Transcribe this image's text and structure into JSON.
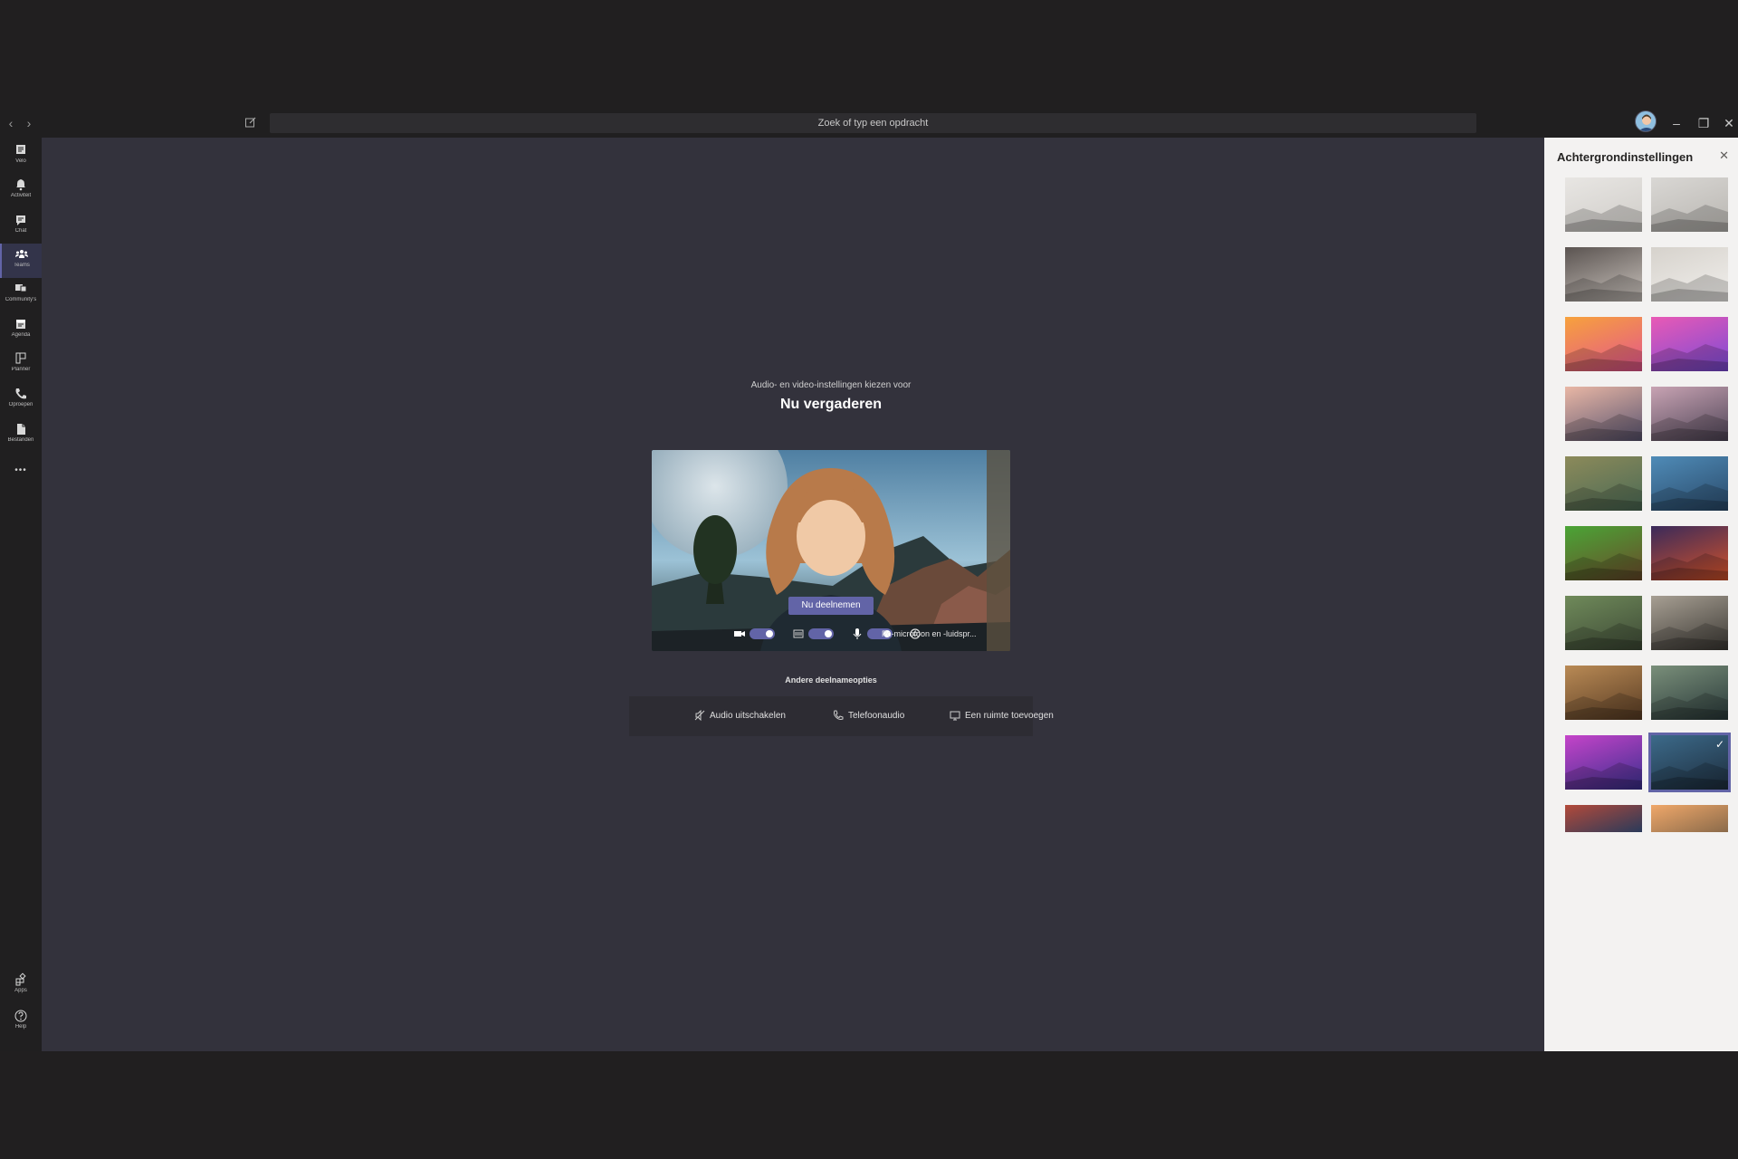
{
  "titlebar": {
    "back_icon": "chevron-left-icon",
    "forward_icon": "chevron-right-icon",
    "compose_icon": "compose-icon",
    "search_placeholder": "Zoek of typ een opdracht",
    "minimize_glyph": "–",
    "restore_glyph": "❐",
    "close_glyph": "✕"
  },
  "rail": {
    "items": [
      {
        "label": "Velo",
        "icon": "feed-icon"
      },
      {
        "label": "Activiteit",
        "icon": "bell-icon"
      },
      {
        "label": "Chat",
        "icon": "chat-icon"
      },
      {
        "label": "Teams",
        "icon": "teams-icon",
        "active": true
      },
      {
        "label": "Community's",
        "icon": "community-icon"
      },
      {
        "label": "Agenda",
        "icon": "calendar-icon"
      },
      {
        "label": "Planner",
        "icon": "planner-icon"
      },
      {
        "label": "Oproepen",
        "icon": "phone-icon"
      },
      {
        "label": "Bestanden",
        "icon": "files-icon"
      }
    ],
    "more_glyph": "•••",
    "apps_label": "Apps",
    "help_label": "Help"
  },
  "prejoin": {
    "subtitle": "Audio- en video-instellingen kiezen voor",
    "title": "Nu vergaderen",
    "join_label": "Nu deelnemen",
    "device_label": "Pc-microfoon en -luidspr...",
    "camera_on": true,
    "blur_on": true,
    "mic_on": true
  },
  "other_options": {
    "title": "Andere deelnameopties",
    "items": [
      {
        "label": "Audio uitschakelen",
        "icon": "speaker-off-icon"
      },
      {
        "label": "Telefoonaudio",
        "icon": "phone-icon"
      },
      {
        "label": "Een ruimte toevoegen",
        "icon": "room-icon"
      }
    ]
  },
  "background_panel": {
    "title": "Achtergrondinstellingen",
    "close_glyph": "✕",
    "selected_index": 17,
    "thumbnails": [
      {
        "name": "white-room-1",
        "colors": [
          "#e8e6e3",
          "#cfccc8"
        ]
      },
      {
        "name": "white-room-2",
        "colors": [
          "#d9d7d4",
          "#b9b6b1"
        ]
      },
      {
        "name": "office-glass",
        "colors": [
          "#5a5350",
          "#c9c2bc"
        ]
      },
      {
        "name": "white-loft",
        "colors": [
          "#d6d2cc",
          "#f1efec"
        ]
      },
      {
        "name": "balloons-orange",
        "colors": [
          "#f7a23c",
          "#e3548d"
        ]
      },
      {
        "name": "balloons-pink",
        "colors": [
          "#e95ab5",
          "#7a4ad6"
        ]
      },
      {
        "name": "bridge-sunset",
        "colors": [
          "#e9b7a5",
          "#5a5470"
        ]
      },
      {
        "name": "arch-rock",
        "colors": [
          "#c8a3b3",
          "#4f4557"
        ]
      },
      {
        "name": "classroom",
        "colors": [
          "#8c8a5a",
          "#4b6a55"
        ]
      },
      {
        "name": "blue-lab",
        "colors": [
          "#4f8bb7",
          "#2a4a6a"
        ]
      },
      {
        "name": "minecraft-green",
        "colors": [
          "#4aa536",
          "#6a4a2a"
        ]
      },
      {
        "name": "minecraft-night",
        "colors": [
          "#3a2a5a",
          "#d2522a"
        ]
      },
      {
        "name": "valley-green",
        "colors": [
          "#6f8a5a",
          "#3e4a36"
        ]
      },
      {
        "name": "stone-ring",
        "colors": [
          "#a79f93",
          "#3d3a35"
        ]
      },
      {
        "name": "desert-street",
        "colors": [
          "#b98a55",
          "#5a3d24"
        ]
      },
      {
        "name": "sci-fi-sun",
        "colors": [
          "#7a8f7a",
          "#2a3a3a"
        ]
      },
      {
        "name": "nebula",
        "colors": [
          "#c544c9",
          "#3a2f8e"
        ]
      },
      {
        "name": "alien-coast",
        "colors": [
          "#3c6a8a",
          "#1e2e3e"
        ]
      },
      {
        "name": "red-canyon",
        "colors": [
          "#b34a3a",
          "#2a3a5a"
        ]
      },
      {
        "name": "orange-sky",
        "colors": [
          "#f0a86a",
          "#8a6a4a"
        ]
      }
    ]
  }
}
